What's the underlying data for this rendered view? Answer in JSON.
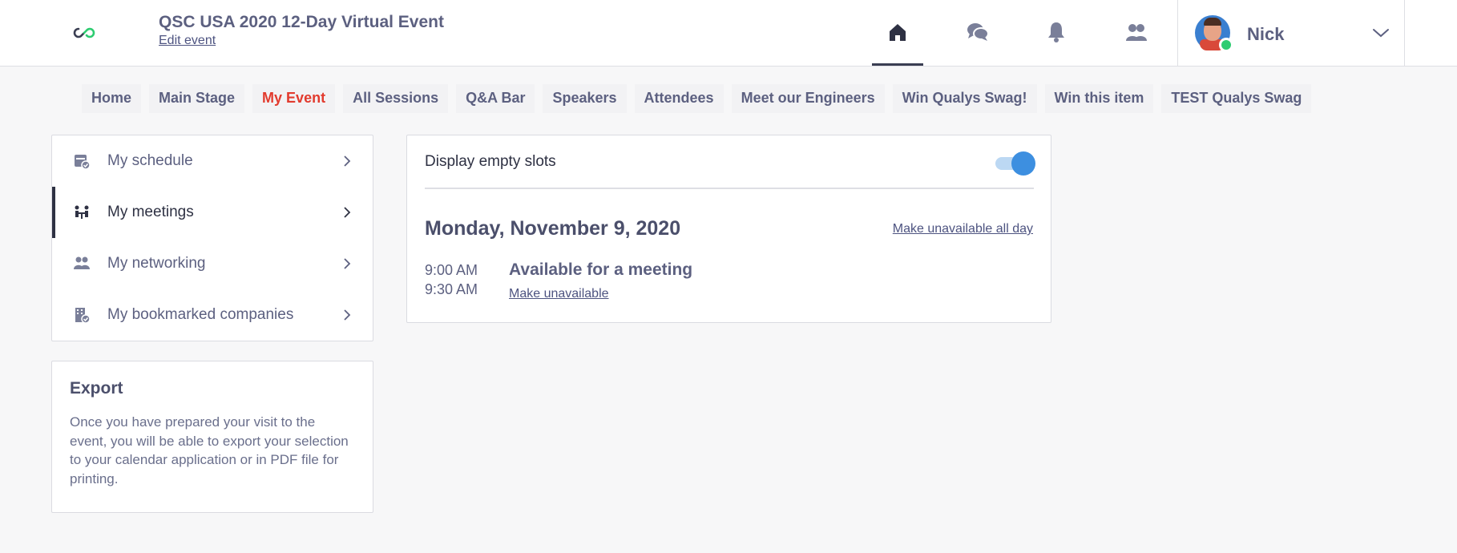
{
  "header": {
    "event_title": "QSC USA 2020 12-Day Virtual Event",
    "edit_event": "Edit event",
    "user_name": "Nick"
  },
  "nav_icons": [
    "home-icon",
    "chat-icon",
    "bell-icon",
    "people-icon"
  ],
  "tabs": [
    {
      "label": "Home"
    },
    {
      "label": "Main Stage"
    },
    {
      "label": "My Event",
      "active": true
    },
    {
      "label": "All Sessions"
    },
    {
      "label": "Q&A Bar"
    },
    {
      "label": "Speakers"
    },
    {
      "label": "Attendees"
    },
    {
      "label": "Meet our Engineers"
    },
    {
      "label": "Win Qualys Swag!"
    },
    {
      "label": "Win this item"
    },
    {
      "label": "TEST Qualys Swag"
    }
  ],
  "menu": {
    "items": [
      {
        "label": "My schedule",
        "icon": "calendar-check-icon"
      },
      {
        "label": "My meetings",
        "icon": "meeting-icon",
        "active": true
      },
      {
        "label": "My networking",
        "icon": "networking-icon"
      },
      {
        "label": "My bookmarked companies",
        "icon": "building-check-icon"
      }
    ]
  },
  "export": {
    "title": "Export",
    "text": "Once you have prepared your visit to the event, you will be able to export your selection to your calendar application or in PDF file for printing."
  },
  "schedule": {
    "display_empty_label": "Display empty slots",
    "display_empty_on": true,
    "day_title": "Monday, November 9, 2020",
    "make_unavailable_all_day": "Make unavailable all day",
    "slot": {
      "start": "9:00 AM",
      "end": "9:30 AM",
      "status": "Available for a meeting",
      "action": "Make unavailable"
    }
  },
  "colors": {
    "accent_active_tab": "#e23b2e",
    "toggle": "#3d8fe0",
    "online": "#2ecc71",
    "text": "#5c6080"
  }
}
